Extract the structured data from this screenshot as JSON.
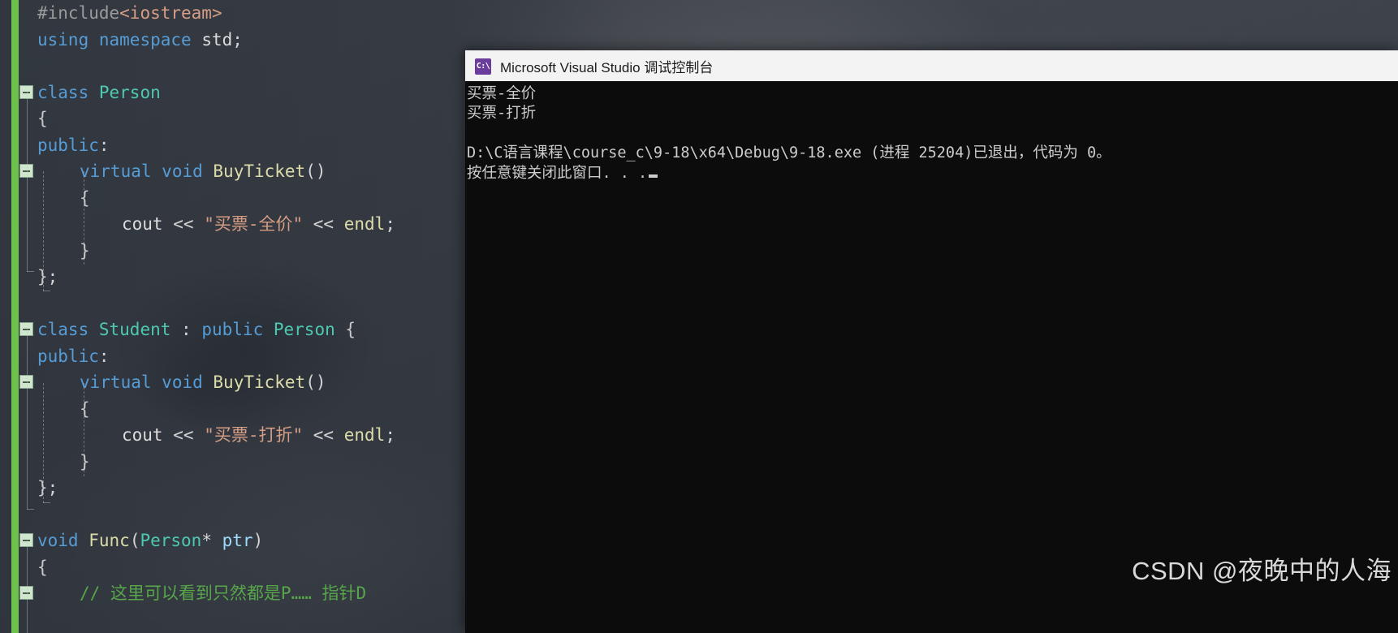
{
  "editor": {
    "name": "visual-studio-code-editor",
    "change_bar_color": "#6cc24a",
    "background_color": "#3b4149",
    "lines": [
      {
        "id": "l1",
        "indent": 0,
        "fold": false,
        "tokens": [
          {
            "c": "pr",
            "t": "#include"
          },
          {
            "c": "s",
            "t": "<iostream>"
          }
        ]
      },
      {
        "id": "l2",
        "indent": 0,
        "fold": false,
        "tokens": [
          {
            "c": "k",
            "t": "using"
          },
          {
            "c": "p",
            "t": " "
          },
          {
            "c": "k",
            "t": "namespace"
          },
          {
            "c": "p",
            "t": " "
          },
          {
            "c": "p",
            "t": "std"
          },
          {
            "c": "op",
            "t": ";"
          }
        ]
      },
      {
        "id": "l3",
        "indent": 0,
        "fold": false,
        "tokens": []
      },
      {
        "id": "l4",
        "indent": 0,
        "fold": true,
        "tokens": [
          {
            "c": "k",
            "t": "class"
          },
          {
            "c": "p",
            "t": " "
          },
          {
            "c": "t",
            "t": "Person"
          }
        ]
      },
      {
        "id": "l5",
        "indent": 0,
        "fold": false,
        "tokens": [
          {
            "c": "brace",
            "t": "{"
          }
        ]
      },
      {
        "id": "l6",
        "indent": 0,
        "fold": false,
        "tokens": [
          {
            "c": "k",
            "t": "public"
          },
          {
            "c": "op",
            "t": ":"
          }
        ]
      },
      {
        "id": "l7",
        "indent": 1,
        "fold": true,
        "tokens": [
          {
            "c": "k",
            "t": "virtual"
          },
          {
            "c": "p",
            "t": " "
          },
          {
            "c": "k",
            "t": "void"
          },
          {
            "c": "p",
            "t": " "
          },
          {
            "c": "f",
            "t": "BuyTicket"
          },
          {
            "c": "op",
            "t": "()"
          }
        ]
      },
      {
        "id": "l8",
        "indent": 1,
        "fold": false,
        "tokens": [
          {
            "c": "brace",
            "t": "{"
          }
        ]
      },
      {
        "id": "l9",
        "indent": 2,
        "fold": false,
        "tokens": [
          {
            "c": "p",
            "t": "cout"
          },
          {
            "c": "p",
            "t": " "
          },
          {
            "c": "op",
            "t": "<<"
          },
          {
            "c": "p",
            "t": " "
          },
          {
            "c": "s",
            "t": "\"买票-全价\""
          },
          {
            "c": "p",
            "t": " "
          },
          {
            "c": "op",
            "t": "<<"
          },
          {
            "c": "p",
            "t": " "
          },
          {
            "c": "f",
            "t": "endl"
          },
          {
            "c": "op",
            "t": ";"
          }
        ]
      },
      {
        "id": "l10",
        "indent": 1,
        "fold": false,
        "tokens": [
          {
            "c": "brace",
            "t": "}"
          }
        ]
      },
      {
        "id": "l11",
        "indent": 0,
        "fold": false,
        "tokens": [
          {
            "c": "brace",
            "t": "}"
          },
          {
            "c": "op",
            "t": ";"
          }
        ]
      },
      {
        "id": "l12",
        "indent": 0,
        "fold": false,
        "tokens": []
      },
      {
        "id": "l13",
        "indent": 0,
        "fold": true,
        "tokens": [
          {
            "c": "k",
            "t": "class"
          },
          {
            "c": "p",
            "t": " "
          },
          {
            "c": "t",
            "t": "Student"
          },
          {
            "c": "p",
            "t": " "
          },
          {
            "c": "op",
            "t": ":"
          },
          {
            "c": "p",
            "t": " "
          },
          {
            "c": "k",
            "t": "public"
          },
          {
            "c": "p",
            "t": " "
          },
          {
            "c": "t",
            "t": "Person"
          },
          {
            "c": "p",
            "t": " "
          },
          {
            "c": "brace",
            "t": "{"
          }
        ]
      },
      {
        "id": "l14",
        "indent": 0,
        "fold": false,
        "tokens": [
          {
            "c": "k",
            "t": "public"
          },
          {
            "c": "op",
            "t": ":"
          }
        ]
      },
      {
        "id": "l15",
        "indent": 1,
        "fold": true,
        "tokens": [
          {
            "c": "k",
            "t": "virtual"
          },
          {
            "c": "p",
            "t": " "
          },
          {
            "c": "k",
            "t": "void"
          },
          {
            "c": "p",
            "t": " "
          },
          {
            "c": "f",
            "t": "BuyTicket"
          },
          {
            "c": "op",
            "t": "()"
          }
        ]
      },
      {
        "id": "l16",
        "indent": 1,
        "fold": false,
        "tokens": [
          {
            "c": "brace",
            "t": "{"
          }
        ]
      },
      {
        "id": "l17",
        "indent": 2,
        "fold": false,
        "tokens": [
          {
            "c": "p",
            "t": "cout"
          },
          {
            "c": "p",
            "t": " "
          },
          {
            "c": "op",
            "t": "<<"
          },
          {
            "c": "p",
            "t": " "
          },
          {
            "c": "s",
            "t": "\"买票-打折\""
          },
          {
            "c": "p",
            "t": " "
          },
          {
            "c": "op",
            "t": "<<"
          },
          {
            "c": "p",
            "t": " "
          },
          {
            "c": "f",
            "t": "endl"
          },
          {
            "c": "op",
            "t": ";"
          }
        ]
      },
      {
        "id": "l18",
        "indent": 1,
        "fold": false,
        "tokens": [
          {
            "c": "brace",
            "t": "}"
          }
        ]
      },
      {
        "id": "l19",
        "indent": 0,
        "fold": false,
        "tokens": [
          {
            "c": "brace",
            "t": "}"
          },
          {
            "c": "op",
            "t": ";"
          }
        ]
      },
      {
        "id": "l20",
        "indent": 0,
        "fold": false,
        "tokens": []
      },
      {
        "id": "l21",
        "indent": 0,
        "fold": true,
        "tokens": [
          {
            "c": "k",
            "t": "void"
          },
          {
            "c": "p",
            "t": " "
          },
          {
            "c": "f",
            "t": "Func"
          },
          {
            "c": "op",
            "t": "("
          },
          {
            "c": "t",
            "t": "Person"
          },
          {
            "c": "op",
            "t": "* "
          },
          {
            "c": "v",
            "t": "ptr"
          },
          {
            "c": "op",
            "t": ")"
          }
        ]
      },
      {
        "id": "l22",
        "indent": 0,
        "fold": false,
        "tokens": [
          {
            "c": "brace",
            "t": "{"
          }
        ]
      },
      {
        "id": "l23",
        "indent": 1,
        "fold": true,
        "tokens": [
          {
            "c": "cm",
            "t": "// 这里可以看到只然都是P…… 指针D"
          }
        ]
      }
    ]
  },
  "console": {
    "title": "Microsoft Visual Studio 调试控制台",
    "icon": "cmd-console-icon",
    "icon_glyph": "C:\\",
    "background_color": "#0c0c0c",
    "text_color": "#cccccc",
    "output_lines": [
      "买票-全价",
      "买票-打折",
      "",
      "D:\\C语言课程\\course_c\\9-18\\x64\\Debug\\9-18.exe (进程 25204)已退出，代码为 0。"
    ],
    "prompt_line": "按任意键关闭此窗口. . .",
    "exit_code": "0",
    "process_id": "25204",
    "exe_path": "D:\\C语言课程\\course_c\\9-18\\x64\\Debug\\9-18.exe"
  },
  "watermark": {
    "text": "CSDN @夜晚中的人海"
  }
}
